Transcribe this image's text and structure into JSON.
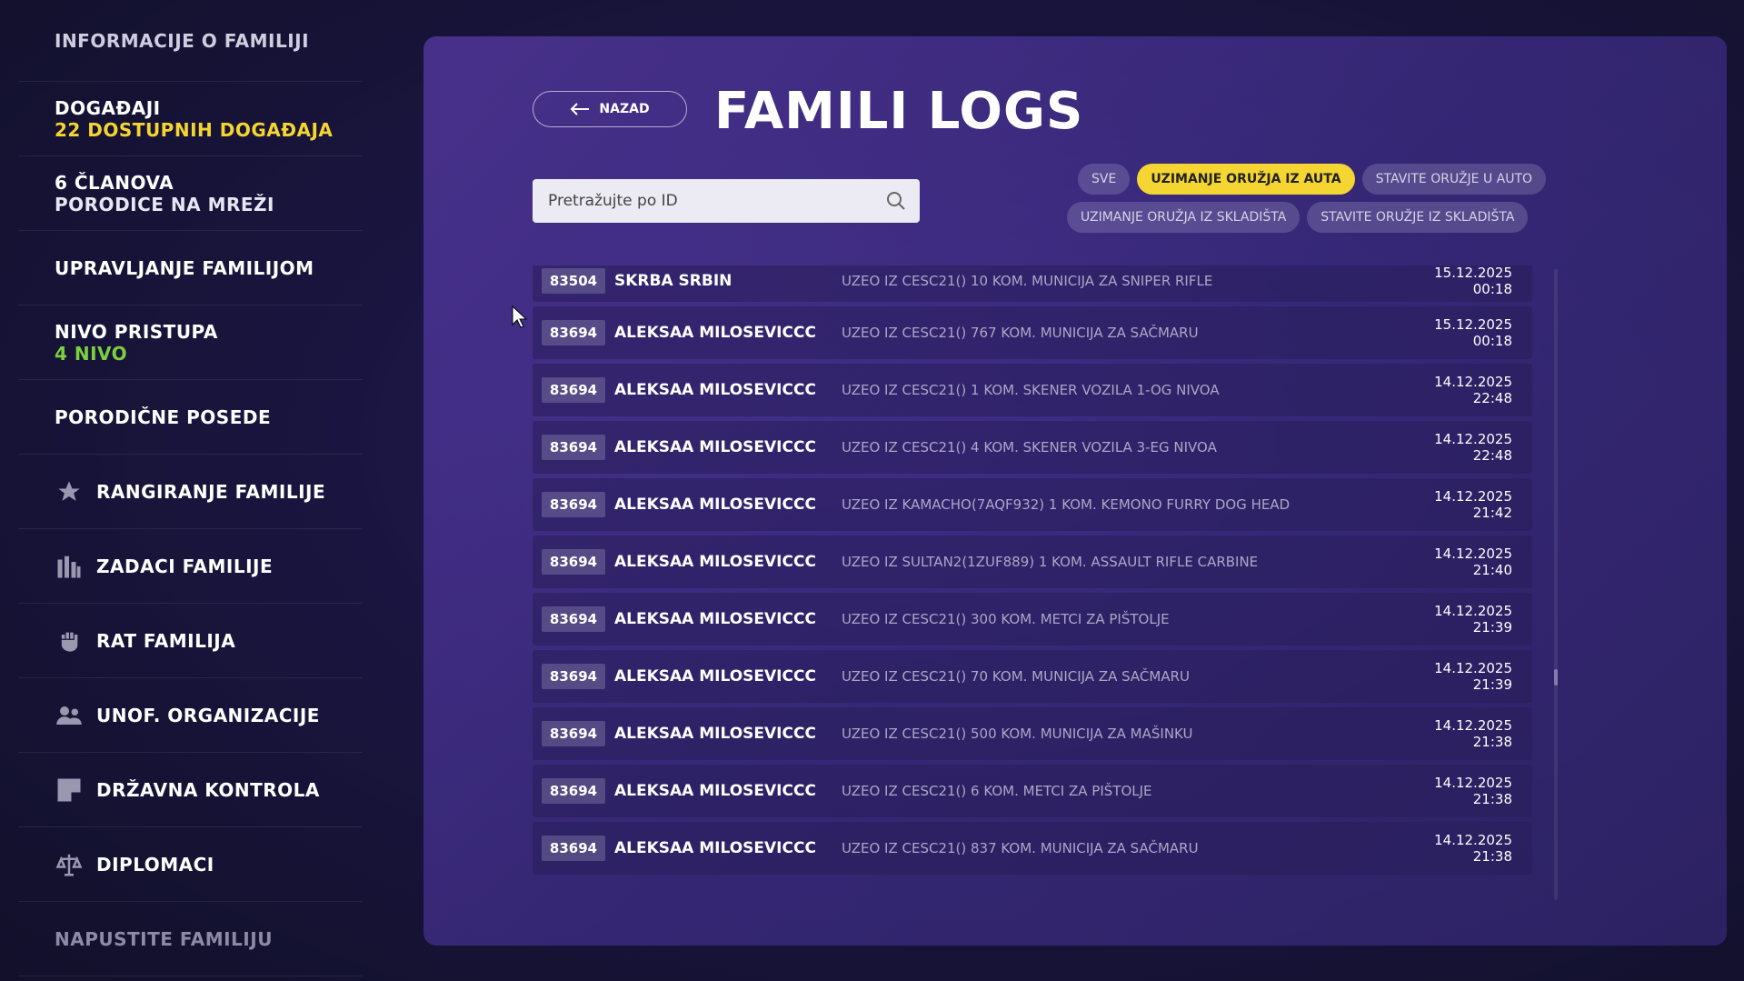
{
  "sidebar": {
    "items": [
      {
        "label": "INFORMACIJE O FAMILIJI"
      },
      {
        "label": "DOGAĐAJI",
        "sub": "22 DOSTUPNIH DOGAĐAJA"
      },
      {
        "label": "6 ČLANOVA",
        "sub": "PORODICE NA MREŽI"
      },
      {
        "label": "UPRAVLJANJE FAMILIJOM"
      },
      {
        "label": "NIVO PRISTUPA",
        "sub": "4 NIVO"
      },
      {
        "label": "PORODIČNE POSEDE"
      },
      {
        "label": "RANGIRANJE FAMILIJE",
        "icon": "star-icon"
      },
      {
        "label": "ZADACI FAMILIJE",
        "icon": "bars-icon"
      },
      {
        "label": "RAT FAMILIJA",
        "icon": "fist-icon"
      },
      {
        "label": "UNOF. ORGANIZACIJE",
        "icon": "people-icon"
      },
      {
        "label": "DRŽAVNA KONTROLA",
        "icon": "territory-icon"
      },
      {
        "label": "DIPLOMACI",
        "icon": "scales-icon"
      },
      {
        "label": "NAPUSTITE FAMILIJU"
      }
    ]
  },
  "header": {
    "back_label": "NAZAD",
    "title": "FAMILI LOGS"
  },
  "search": {
    "placeholder": "Pretražujte po ID"
  },
  "filters": {
    "row1": [
      "SVE",
      "UZIMANJE ORUŽJA IZ AUTA",
      "STAVITE ORUŽJE U AUTO"
    ],
    "row2": [
      "UZIMANJE ORUŽJA IZ SKLADIŠTA",
      "STAVITE ORUŽJE IZ SKLADIŠTA"
    ],
    "active": "UZIMANJE ORUŽJA IZ AUTA"
  },
  "logs": [
    {
      "id": "83504",
      "name": "SKRBA SRBIN",
      "desc": "UZEO IZ CESC21() 10 KOM. MUNICIJA ZA SNIPER RIFLE",
      "time": "15.12.2025 00:18"
    },
    {
      "id": "83694",
      "name": "ALEKSAA MILOSEVICCC",
      "desc": "UZEO IZ CESC21() 767 KOM. MUNICIJA ZA SAČMARU",
      "time": "15.12.2025 00:18"
    },
    {
      "id": "83694",
      "name": "ALEKSAA MILOSEVICCC",
      "desc": "UZEO IZ CESC21() 1 KOM. SKENER VOZILA 1-OG NIVOA",
      "time": "14.12.2025 22:48"
    },
    {
      "id": "83694",
      "name": "ALEKSAA MILOSEVICCC",
      "desc": "UZEO IZ CESC21() 4 KOM. SKENER VOZILA 3-EG NIVOA",
      "time": "14.12.2025 22:48"
    },
    {
      "id": "83694",
      "name": "ALEKSAA MILOSEVICCC",
      "desc": "UZEO IZ KAMACHO(7AQF932) 1 KOM. KEMONO FURRY DOG HEAD",
      "time": "14.12.2025 21:42"
    },
    {
      "id": "83694",
      "name": "ALEKSAA MILOSEVICCC",
      "desc": "UZEO IZ SULTAN2(1ZUF889) 1 KOM. ASSAULT RIFLE CARBINE",
      "time": "14.12.2025 21:40"
    },
    {
      "id": "83694",
      "name": "ALEKSAA MILOSEVICCC",
      "desc": "UZEO IZ CESC21() 300 KOM. METCI ZA PIŠTOLJE",
      "time": "14.12.2025 21:39"
    },
    {
      "id": "83694",
      "name": "ALEKSAA MILOSEVICCC",
      "desc": "UZEO IZ CESC21() 70 KOM. MUNICIJA ZA SAČMARU",
      "time": "14.12.2025 21:39"
    },
    {
      "id": "83694",
      "name": "ALEKSAA MILOSEVICCC",
      "desc": "UZEO IZ CESC21() 500 KOM. MUNICIJA ZA MAŠINKU",
      "time": "14.12.2025 21:38"
    },
    {
      "id": "83694",
      "name": "ALEKSAA MILOSEVICCC",
      "desc": "UZEO IZ CESC21() 6 KOM. METCI ZA PIŠTOLJE",
      "time": "14.12.2025 21:38"
    },
    {
      "id": "83694",
      "name": "ALEKSAA MILOSEVICCC",
      "desc": "UZEO IZ CESC21() 837 KOM. MUNICIJA ZA SAČMARU",
      "time": "14.12.2025 21:38"
    }
  ],
  "colors": {
    "accent_yellow": "#f5d531",
    "accent_green": "#7ad13e"
  }
}
